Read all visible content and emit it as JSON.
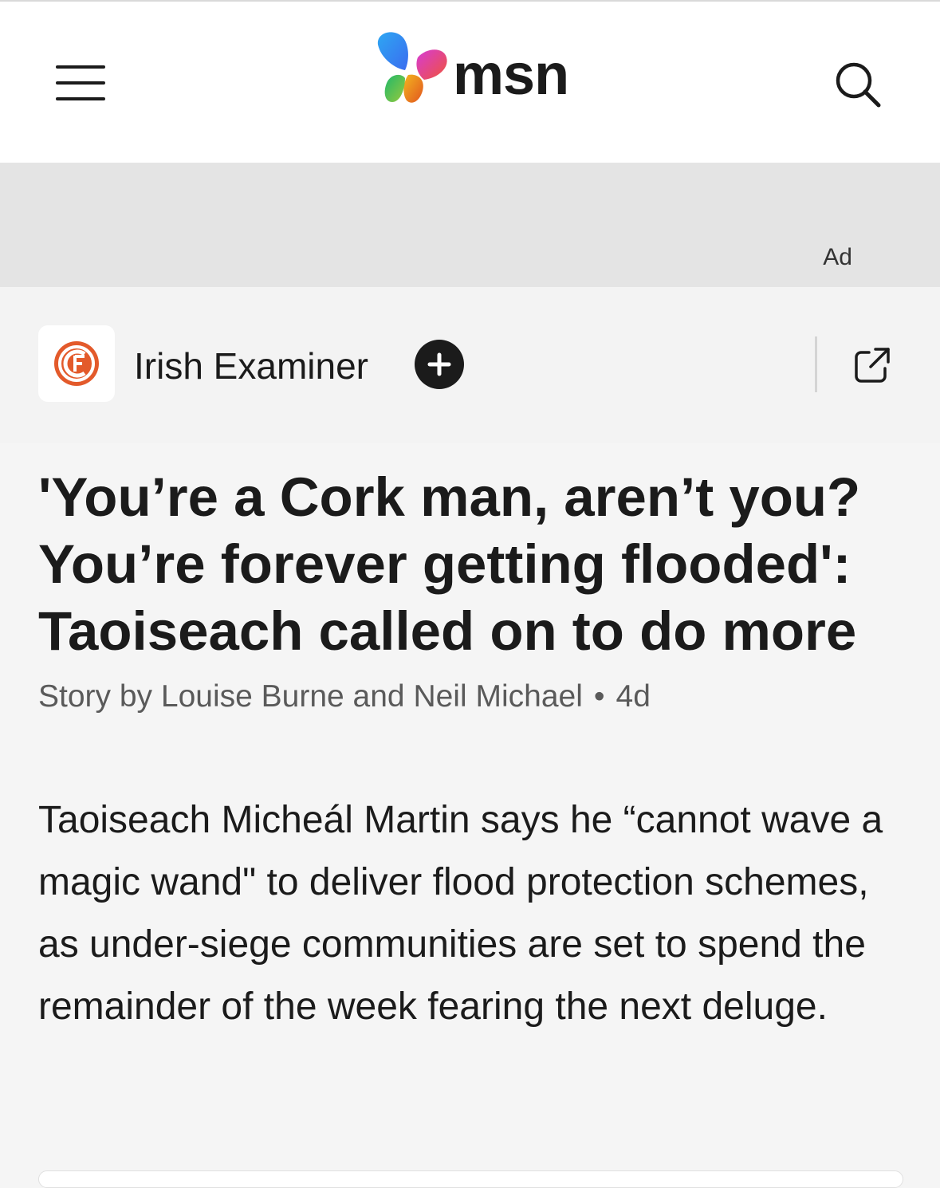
{
  "header": {
    "brand": "msn",
    "menu_icon": "hamburger-menu-icon",
    "search_icon": "search-icon"
  },
  "ad": {
    "label": "Ad"
  },
  "source": {
    "name": "Irish Examiner",
    "logo_icon": "irish-examiner-logo",
    "follow_icon": "plus-icon",
    "share_icon": "external-link-icon",
    "brand_color": "#e35a2b"
  },
  "article": {
    "headline": "'You’re a Cork man, aren’t you? You’re forever getting flooded': Taoiseach called on to do more",
    "byline": "Story by Louise Burne and Neil Michael",
    "separator": "•",
    "age": "4d",
    "body": "Taoiseach Micheál Martin says he “cannot wave a magic wand\" to deliver flood protection schemes, as under-siege communities are set to spend the remainder of the week fearing the next deluge."
  }
}
